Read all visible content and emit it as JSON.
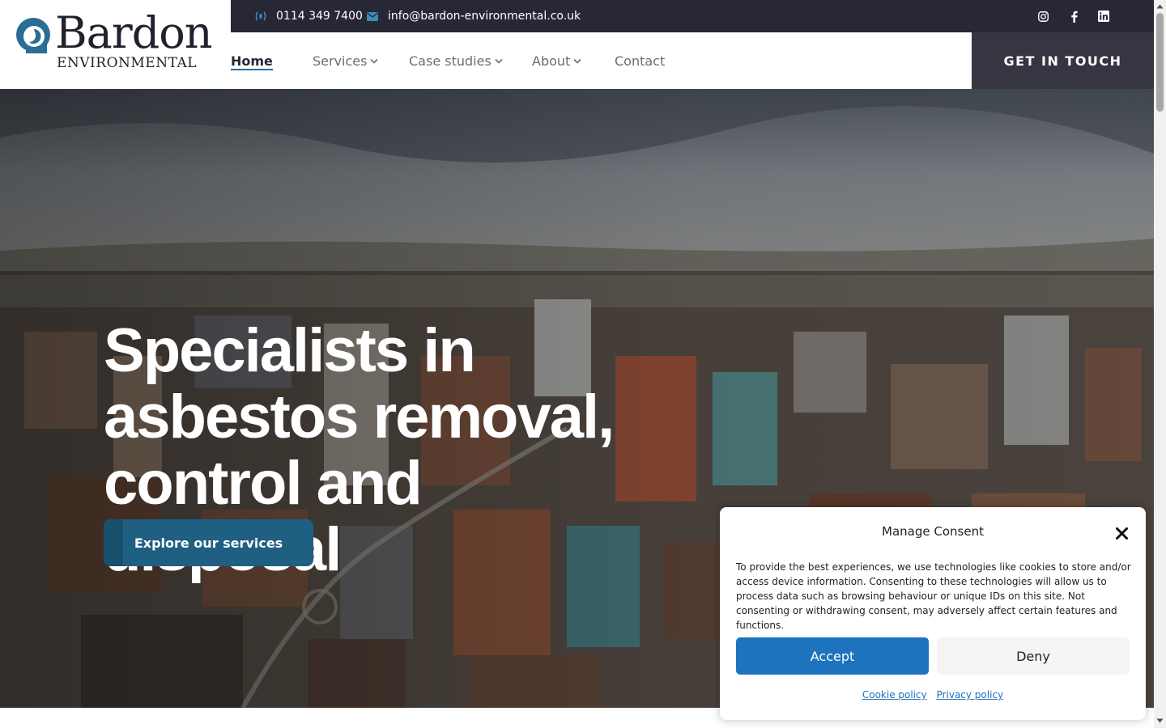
{
  "logo": {
    "word": "Bardon",
    "sub": "ENVIRONMENTAL"
  },
  "topbar": {
    "phone": "0114 349 7400",
    "email": "info@bardon-environmental.co.uk",
    "socials": [
      "instagram-icon",
      "facebook-icon",
      "linkedin-icon"
    ]
  },
  "nav": {
    "items": [
      {
        "label": "Home",
        "active": true,
        "dropdown": false
      },
      {
        "label": "Services",
        "active": false,
        "dropdown": true
      },
      {
        "label": "Case studies",
        "active": false,
        "dropdown": true
      },
      {
        "label": "About",
        "active": false,
        "dropdown": true
      },
      {
        "label": "Contact",
        "active": false,
        "dropdown": false
      }
    ],
    "cta": "GET IN TOUCH"
  },
  "hero": {
    "title_lines": [
      "Specialists in",
      "asbestos removal,",
      "control and",
      "disposal"
    ],
    "button": "Explore our services"
  },
  "consent": {
    "title": "Manage Consent",
    "text": "To provide the best experiences, we use technologies like cookies to store and/or access device information. Consenting to these technologies will allow us to process data such as browsing behaviour or unique IDs on this site. Not consenting or withdrawing consent, may adversely affect certain features and functions.",
    "accept": "Accept",
    "deny": "Deny",
    "links": [
      "Cookie policy",
      "Privacy policy"
    ]
  },
  "colors": {
    "topbar": "#272735",
    "cta": "#363642",
    "accent": "#2a6e94",
    "hero_button": "#1f5f82",
    "accept": "#1e73be"
  }
}
